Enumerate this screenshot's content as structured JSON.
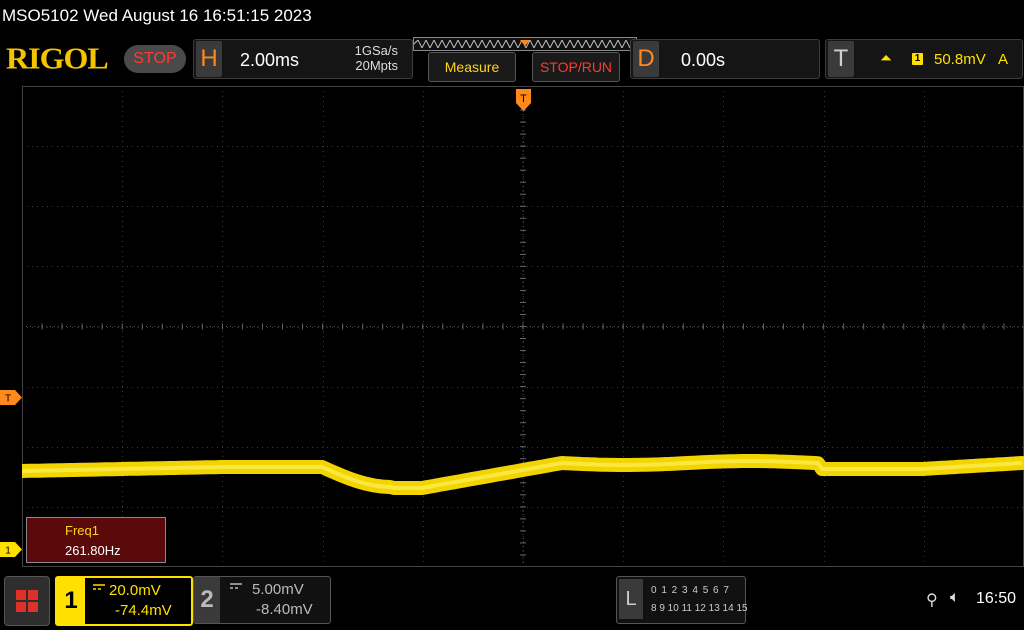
{
  "status_line": "MSO5102  Wed August 16 16:51:15 2023",
  "header": {
    "logo": "RIGOL",
    "run_state": "STOP",
    "horizontal": {
      "tag": "H",
      "timebase": "2.00ms",
      "sample_rate": "1GSa/s",
      "memory_depth": "20Mpts"
    },
    "measure_label": "Measure",
    "stoprun_label": "STOP/RUN",
    "delay": {
      "tag": "D",
      "value": "0.00s"
    },
    "trigger": {
      "tag": "T",
      "source": "1",
      "level": "50.8mV",
      "mode": "A"
    }
  },
  "screen": {
    "trigger_position_marker": "T",
    "trigger_level_marker": "T",
    "ch1_marker": "1",
    "measurement": {
      "label": "Freq1",
      "value": "261.80Hz"
    }
  },
  "channels": [
    {
      "number": "1",
      "scale": "20.0mV",
      "offset": "-74.4mV",
      "active": true,
      "color": "#ffe000"
    },
    {
      "number": "2",
      "scale": "5.00mV",
      "offset": "-8.40mV",
      "active": false,
      "color": "#bbbbbb"
    }
  ],
  "logic": {
    "tag": "L",
    "row1": "0 1 2 3  4 5 6 7",
    "row2": "8 9 10 11 12 13 14 15"
  },
  "system": {
    "usb_icon": "usb-icon",
    "speaker_icon": "speaker-muted-icon",
    "time": "16:50"
  },
  "colors": {
    "ch1": "#ffe000",
    "accent": "#ff8a1c",
    "stop": "#ff3b2f"
  }
}
